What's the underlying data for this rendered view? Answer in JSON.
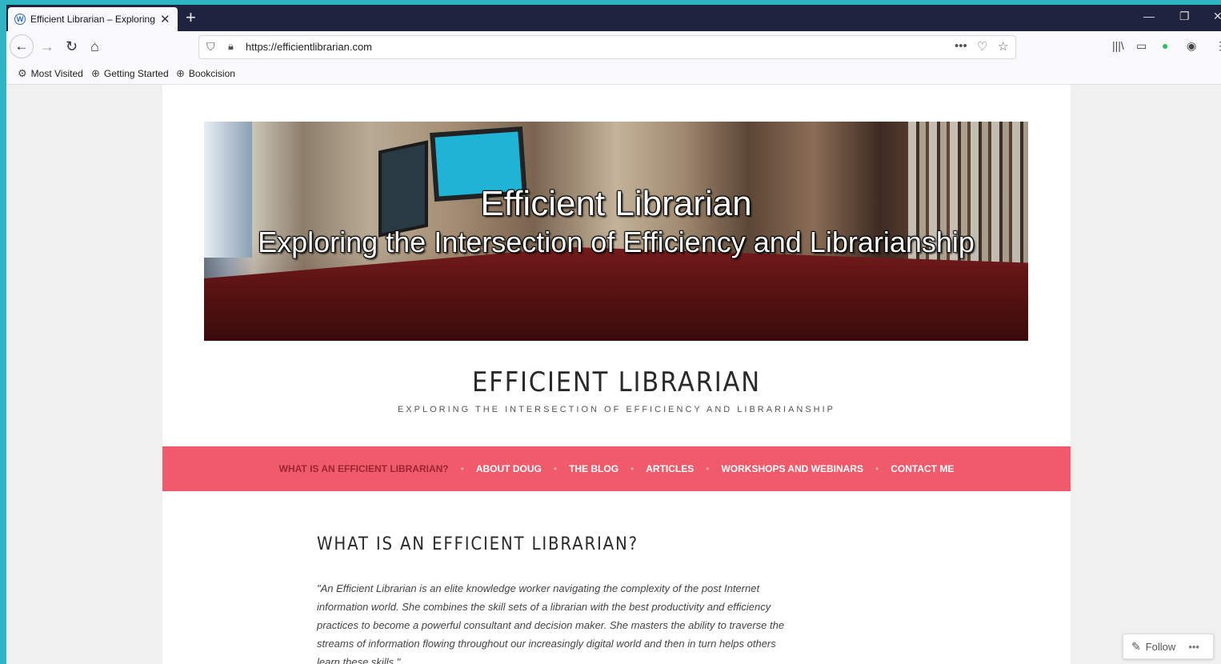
{
  "browser": {
    "tab_title": "Efficient Librarian – Exploring the Intersection",
    "tab_close": "✕",
    "new_tab": "+",
    "url": "https://efficientlibrarian.com",
    "page_actions": "•••",
    "bookmarks": [
      {
        "label": "Most Visited",
        "icon": "gear-icon"
      },
      {
        "label": "Getting Started",
        "icon": "globe-icon"
      },
      {
        "label": "Bookcision",
        "icon": "globe-icon"
      }
    ]
  },
  "site": {
    "banner_title": "Efficient Librarian",
    "banner_subtitle": "Exploring the Intersection of Efficiency and Librarianship",
    "title": "EFFICIENT LIBRARIAN",
    "tagline": "EXPLORING THE INTERSECTION OF EFFICIENCY AND LIBRARIANSHIP",
    "menu": [
      "WHAT IS AN EFFICIENT LIBRARIAN?",
      "ABOUT DOUG",
      "THE BLOG",
      "ARTICLES",
      "WORKSHOPS AND WEBINARS",
      "CONTACT ME"
    ],
    "menu_sep": "•",
    "post_title": "WHAT IS AN EFFICIENT LIBRARIAN?",
    "quote": "\"An Efficient Librarian is an elite knowledge worker navigating the complexity of the post Internet information world.  She combines the skill sets of a librarian with the best productivity and efficiency practices to become a powerful consultant and decision maker.  She masters the ability to traverse the streams of information flowing throughout our increasingly digital world and then in turn helps others learn these skills.\"",
    "follow_label": "Follow",
    "follow_more": "•••"
  },
  "colors": {
    "menu_bg": "#ef5b6b",
    "menu_active": "#9e2434",
    "tabbar_bg": "#202340",
    "desktop_bg": "#2fb4c4"
  }
}
